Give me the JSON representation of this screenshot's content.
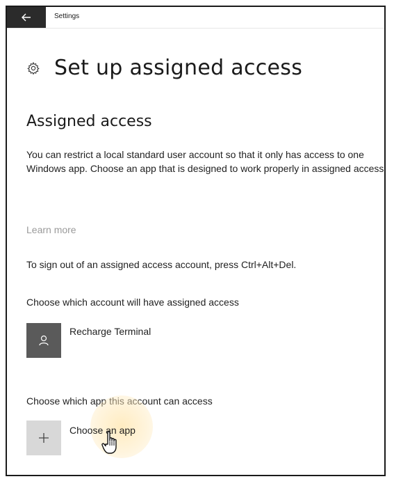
{
  "window": {
    "title": "Settings"
  },
  "page": {
    "title": "Set up assigned access"
  },
  "section": {
    "title": "Assigned access",
    "description": "You can restrict a local standard user account so that it only has access to one Windows app. Choose an app that is designed to work properly in assigned access.",
    "learn_more": "Learn more",
    "sign_out_hint": "To sign out of an assigned access account, press Ctrl+Alt+Del."
  },
  "account": {
    "label": "Choose which account will have assigned access",
    "name": "Recharge Terminal",
    "icon": "person-icon"
  },
  "app": {
    "label": "Choose which app this account can access",
    "button_label": "Choose an app",
    "icon": "plus-icon"
  },
  "colors": {
    "back_button_bg": "#2b2b2b",
    "avatar_bg": "#5a5a5a",
    "plus_tile_bg": "#d8d8d8",
    "link_gray": "#9a9a9a",
    "cursor_highlight": "#ffe2a0"
  }
}
